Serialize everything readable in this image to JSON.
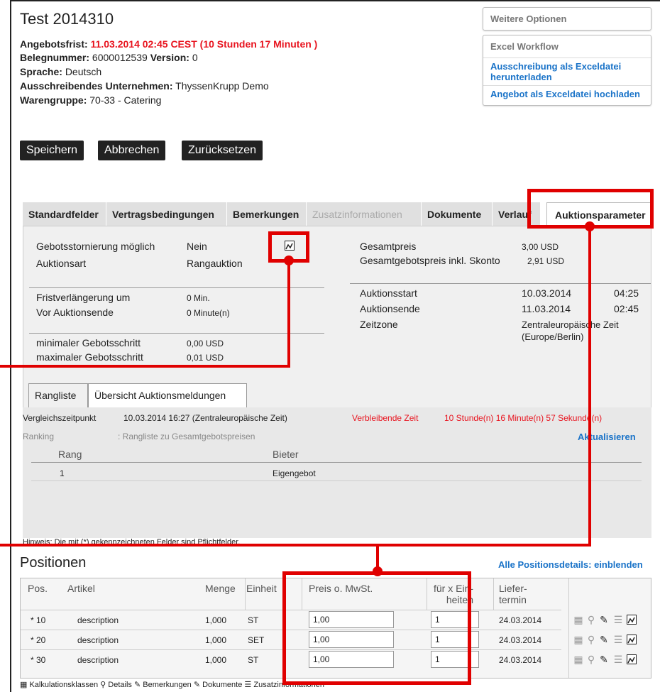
{
  "header": {
    "title": "Test 2014310",
    "deadline_label": "Angebotsfrist:",
    "deadline_value": "11.03.2014  02:45  CEST (10 Stunden 17 Minuten )",
    "doc_number_label": "Belegnummer:",
    "doc_number_value": "6000012539",
    "version_label": "Version:",
    "version_value": "0",
    "language_label": "Sprache:",
    "language_value": "Deutsch",
    "company_label": "Ausschreibendes Unternehmen:",
    "company_value": "ThyssenKrupp Demo",
    "group_label": "Warengruppe:",
    "group_value": "70-33 - Catering"
  },
  "options": {
    "more_options": "Weitere Optionen",
    "excel_header": "Excel Workflow",
    "excel_download": "Ausschreibung als Exceldatei herunterladen",
    "excel_upload": "Angebot als Exceldatei hochladen"
  },
  "toolbar": {
    "save": "Speichern",
    "cancel": "Abbrechen",
    "reset": "Zurücksetzen"
  },
  "tabs": [
    {
      "label": "Standardfelder"
    },
    {
      "label": "Vertragsbedingungen"
    },
    {
      "label": "Bemerkungen"
    },
    {
      "label": "Zusatzinformationen"
    },
    {
      "label": "Dokumente"
    },
    {
      "label": "Verlauf"
    },
    {
      "label": "Auktionsparameter"
    }
  ],
  "auction": {
    "cancel_label": "Gebotsstornierung möglich",
    "cancel_value": "Nein",
    "type_label": "Auktionsart",
    "type_value": "Rangauktion",
    "extension_label": "Fristverlängerung um",
    "extension_value": "0 Min.",
    "before_end_label": "Vor Auktionsende",
    "before_end_value": "0 Minute(n)",
    "min_step_label": "minimaler Gebotsschritt",
    "min_step_value": "0,00 USD",
    "max_step_label": "maximaler Gebotsschritt",
    "max_step_value": "0,01 USD",
    "total_label": "Gesamtpreis",
    "total_value": "3,00 USD",
    "total_skonto_label": "Gesamtgebotspreis inkl. Skonto",
    "total_skonto_value": "2,91 USD",
    "start_label": "Auktionsstart",
    "start_date": "10.03.2014",
    "start_time": "04:25",
    "end_label": "Auktionsende",
    "end_date": "11.03.2014",
    "end_time": "02:45",
    "tz_label": "Zeitzone",
    "tz_value": "Zentraleuropäische Zeit (Europe/Berlin)"
  },
  "subtabs": [
    {
      "label": "Rangliste"
    },
    {
      "label": "Übersicht Auktionsmeldungen"
    }
  ],
  "ranking": {
    "compare_label": "Vergleichszeitpunkt",
    "compare_value": "10.03.2014 16:27 (Zentraleuropäische Zeit)",
    "remaining_label": "Verbleibende Zeit",
    "remaining_value": "10 Stunde(n) 16 Minute(n) 57 Sekunde(n)",
    "ranking_label": "Ranking",
    "ranking_value": ":  Rangliste zu Gesamtgebotspreisen",
    "refresh": "Aktualisieren",
    "col_rank": "Rang",
    "col_bidder": "Bieter",
    "rows": [
      {
        "rank": "1",
        "bidder": "Eigengebot"
      }
    ]
  },
  "hint": "Hinweis: Die mit (*) gekennzeichneten Felder sind Pflichtfelder.",
  "positions": {
    "title": "Positionen",
    "show_all": "Alle Positionsdetails: einblenden",
    "headers": {
      "pos": "Pos.",
      "article": "Artikel",
      "qty": "Menge",
      "unit": "Einheit",
      "price": "Preis o. MwSt.",
      "per_units_1": "für x Ein-",
      "per_units_2": "heiten",
      "delivery_1": "Liefer-",
      "delivery_2": "termin"
    },
    "rows": [
      {
        "pos": "* 10",
        "article": "description",
        "qty": "1,000",
        "unit": "ST",
        "price": "1,00",
        "per": "1",
        "date": "24.03.2014"
      },
      {
        "pos": "* 20",
        "article": "description",
        "qty": "1,000",
        "unit": "SET",
        "price": "1,00",
        "per": "1",
        "date": "24.03.2014"
      },
      {
        "pos": "* 30",
        "article": "description",
        "qty": "1,000",
        "unit": "ST",
        "price": "1,00",
        "per": "1",
        "date": "24.03.2014"
      }
    ]
  },
  "legend": {
    "calc": "Kalkulationsklassen",
    "details": "Details",
    "remarks": "Bemerkungen",
    "documents": "Dokumente",
    "extra": "Zusatzinformationen"
  },
  "icons": [
    "calculator-icon",
    "magnifier-icon",
    "pencil-icon",
    "paperclip-icon",
    "list-icon",
    "graph-icon"
  ],
  "colors": {
    "accent": "#1a73c8",
    "alert": "#e8141f",
    "highlight": "#e00000"
  }
}
